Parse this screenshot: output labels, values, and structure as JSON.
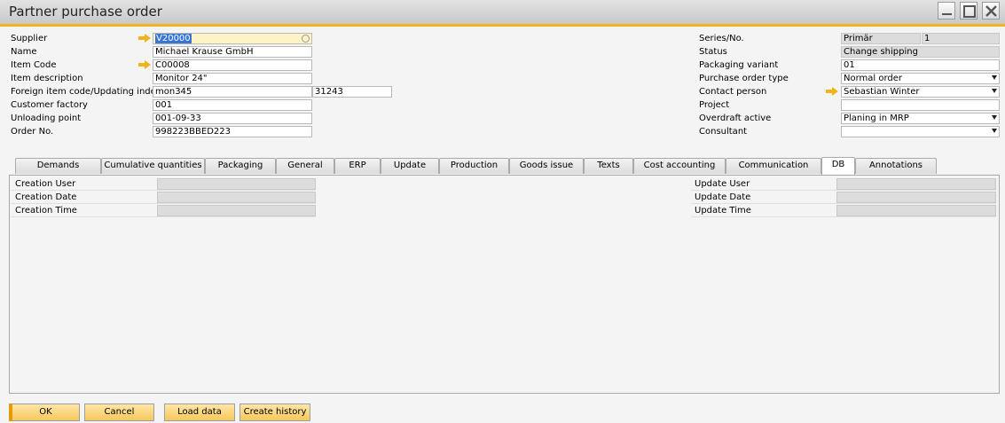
{
  "window": {
    "title": "Partner purchase order",
    "minimize_label": "_",
    "maximize_label": "□",
    "close_label": "✕"
  },
  "left_form": {
    "supplier_label": "Supplier",
    "supplier_value": "V20000",
    "name_label": "Name",
    "name_value": "Michael Krause GmbH",
    "item_code_label": "Item Code",
    "item_code_value": "C00008",
    "item_description_label": "Item description",
    "item_description_value": "Monitor 24\"",
    "foreign_code_label": "Foreign item code/Updating index",
    "foreign_code_value": "mon345",
    "updating_index_value": "31243",
    "customer_factory_label": "Customer factory",
    "customer_factory_value": "001",
    "unloading_point_label": "Unloading point",
    "unloading_point_value": "001-09-33",
    "order_no_label": "Order No.",
    "order_no_value": "998223BBED223"
  },
  "right_form": {
    "series_label": "Series/No.",
    "series_value": "Primär",
    "series_no_value": "1",
    "status_label": "Status",
    "status_value": "Change shipping",
    "packaging_variant_label": "Packaging variant",
    "packaging_variant_value": "01",
    "po_type_label": "Purchase order type",
    "po_type_value": "Normal order",
    "contact_person_label": "Contact person",
    "contact_person_value": "Sebastian Winter",
    "project_label": "Project",
    "project_value": "",
    "overdraft_label": "Overdraft active",
    "overdraft_value": "Planing in MRP",
    "consultant_label": "Consultant",
    "consultant_value": ""
  },
  "tabs": [
    {
      "label": "Demands"
    },
    {
      "label": "Cumulative quantities"
    },
    {
      "label": "Packaging"
    },
    {
      "label": "General"
    },
    {
      "label": "ERP"
    },
    {
      "label": "Update"
    },
    {
      "label": "Production"
    },
    {
      "label": "Goods issue"
    },
    {
      "label": "Texts"
    },
    {
      "label": "Cost accounting"
    },
    {
      "label": "Communication"
    },
    {
      "label": "DB"
    },
    {
      "label": "Annotations"
    }
  ],
  "active_tab": "DB",
  "db_tab": {
    "creation_user_label": "Creation User",
    "creation_date_label": "Creation Date",
    "creation_time_label": "Creation Time",
    "update_user_label": "Update User",
    "update_date_label": "Update Date",
    "update_time_label": "Update Time"
  },
  "buttons": {
    "ok": "OK",
    "cancel": "Cancel",
    "load_data": "Load data",
    "create_history": "Create history"
  },
  "colors": {
    "accent": "#f1b61d",
    "button": "#f6c85c",
    "link_arrow": "#f2b31a"
  }
}
